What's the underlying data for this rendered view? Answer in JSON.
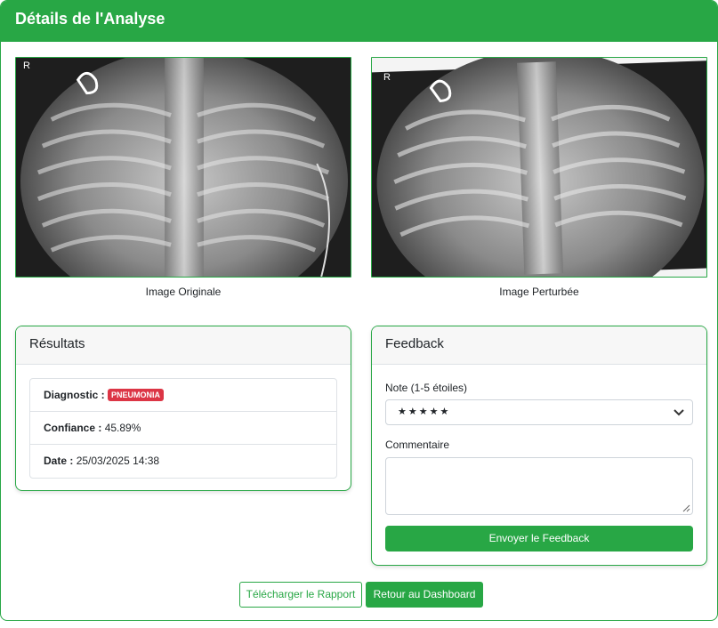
{
  "header": {
    "title": "Détails de l'Analyse"
  },
  "images": {
    "original_caption": "Image Originale",
    "perturbed_caption": "Image Perturbée",
    "marker": "R"
  },
  "results": {
    "title": "Résultats",
    "diagnostic_label": "Diagnostic :",
    "diagnostic_value": "PNEUMONIA",
    "confidence_label": "Confiance :",
    "confidence_value": "45.89%",
    "date_label": "Date :",
    "date_value": "25/03/2025 14:38"
  },
  "feedback": {
    "title": "Feedback",
    "rating_label": "Note (1-5 étoiles)",
    "rating_value": "★★★★★",
    "comment_label": "Commentaire",
    "submit_label": "Envoyer le Feedback"
  },
  "actions": {
    "download_label": "Télécharger le Rapport",
    "dashboard_label": "Retour au Dashboard"
  },
  "colors": {
    "accent": "#28a745",
    "danger": "#dc3545"
  }
}
